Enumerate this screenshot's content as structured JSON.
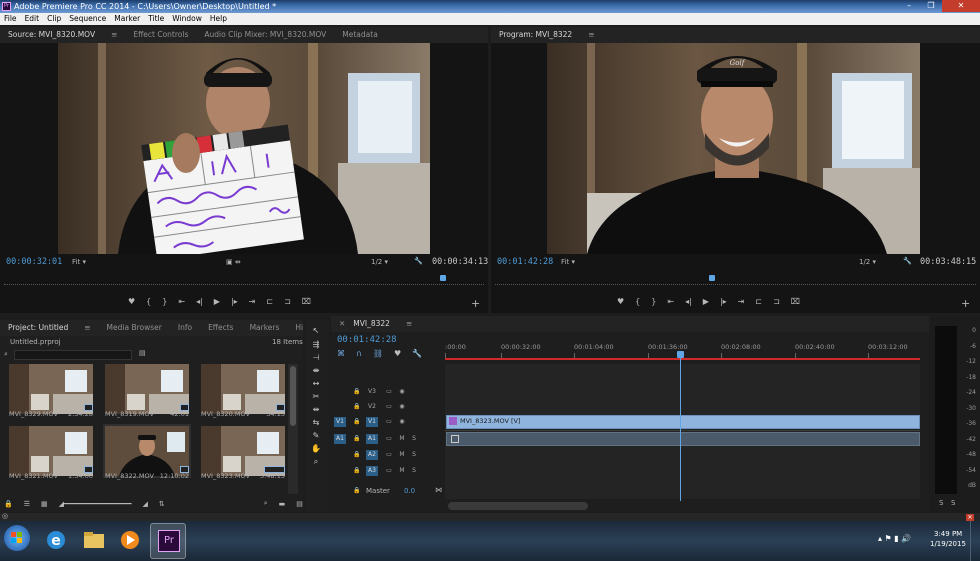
{
  "window": {
    "title": "Adobe Premiere Pro CC 2014 - C:\\Users\\Owner\\Desktop\\Untitled *",
    "minimize": "–",
    "maximize": "❐",
    "close": "✕"
  },
  "menu": [
    "File",
    "Edit",
    "Clip",
    "Sequence",
    "Marker",
    "Title",
    "Window",
    "Help"
  ],
  "source": {
    "tabs": [
      "Source: MVI_8320.MOV",
      "Effect Controls",
      "Audio Clip Mixer: MVI_8320.MOV",
      "Metadata"
    ],
    "timecode_in": "00:00:32:01",
    "fit": "Fit",
    "resolution": "1/2",
    "timecode_out": "00:00:34:13",
    "playhead_progress": 0.92
  },
  "program": {
    "tab": "Program: MVI_8322",
    "timecode_in": "00:01:42:28",
    "fit": "Fit",
    "resolution": "1/2",
    "timecode_out": "00:03:48:15",
    "playhead_progress": 0.45
  },
  "project": {
    "tabs": [
      "Project: Untitled",
      "Media Browser",
      "Info",
      "Effects",
      "Markers",
      "His"
    ],
    "file": "Untitled.prproj",
    "item_count": "18 Items",
    "items": [
      {
        "name": "MVI_8329.MOV",
        "duration": "2:34:28",
        "kind": "room"
      },
      {
        "name": "MVI_8319.MOV",
        "duration": "42:01",
        "kind": "room"
      },
      {
        "name": "MVI_8320.MOV",
        "duration": "34:13",
        "kind": "room"
      },
      {
        "name": "MVI_8321.MOV",
        "duration": "1:34:00",
        "kind": "room"
      },
      {
        "name": "MVI_8322.MOV",
        "duration": "12:10:02",
        "kind": "person"
      },
      {
        "name": "MVI_8323.MOV",
        "duration": "3:48:15",
        "kind": "room"
      }
    ]
  },
  "timeline": {
    "tab": "MVI_8322",
    "timecode": "00:01:42:28",
    "ruler": [
      ":00:00",
      "00:00:32:00",
      "00:01:04:00",
      "00:01:36:00",
      "00:02:08:00",
      "00:02:40:00",
      "00:03:12:00"
    ],
    "video_tracks": [
      "V3",
      "V2",
      "V1"
    ],
    "audio_tracks": [
      "A1",
      "A2",
      "A3"
    ],
    "source_patch_v": "V1",
    "source_patch_a": "A1",
    "clip_label": "MVI_8323.MOV [V]",
    "master_label": "Master",
    "master_value": "0.0",
    "mute": "M",
    "solo": "S"
  },
  "meters": {
    "labels": [
      "0",
      "-6",
      "-12",
      "-18",
      "-24",
      "-30",
      "-36",
      "-42",
      "-48",
      "-54",
      "dB"
    ],
    "solo": [
      "S",
      "S"
    ]
  },
  "taskbar": {
    "time": "3:49 PM",
    "date": "1/19/2015",
    "pr_label": "Pr"
  }
}
